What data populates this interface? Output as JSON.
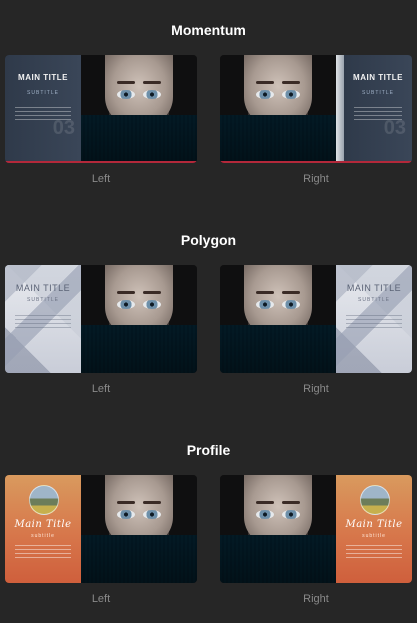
{
  "sections": [
    {
      "title": "Momentum",
      "left_caption": "Left",
      "right_caption": "Right",
      "panel": {
        "main_title": "MAIN TITLE",
        "subtitle": "SUBTITLE",
        "number": "03"
      }
    },
    {
      "title": "Polygon",
      "left_caption": "Left",
      "right_caption": "Right",
      "panel": {
        "main_title": "MAIN TITLE",
        "subtitle": "SUBTITLE"
      }
    },
    {
      "title": "Profile",
      "left_caption": "Left",
      "right_caption": "Right",
      "panel": {
        "main_title": "Main Title",
        "subtitle": "subtitle"
      }
    }
  ],
  "colors": {
    "background": "#262626",
    "caption": "#8a8a8a",
    "momentum_panel": "#33404f",
    "profile_panel": "#d7774b"
  }
}
